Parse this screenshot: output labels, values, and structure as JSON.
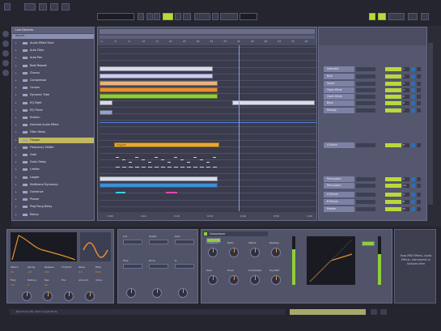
{
  "transport": {
    "buttons": [
      "",
      "",
      "",
      "",
      "",
      "",
      "",
      "",
      "",
      "",
      "",
      "",
      "",
      ""
    ],
    "tempo": "",
    "cpu": "",
    "key": "KEY",
    "midi": "MIDI"
  },
  "browser": {
    "title": "Live Devices",
    "subtitle": "Sound",
    "items": [
      "Audio Effect Rack",
      "Auto Filter",
      "Auto Pan",
      "Beat Repeat",
      "Chorus",
      "Compressor",
      "Corpus",
      "Dynamic Tube",
      "EQ Eight",
      "EQ Three",
      "Erosion",
      "External Audio Effect",
      "Filter Delay",
      "Flanger",
      "Frequency Shifter",
      "Gate",
      "Grain Delay",
      "Limiter",
      "Looper",
      "Multiband Dynamics",
      "Overdrive",
      "Phaser",
      "Ping Pong Delay",
      "Redux"
    ],
    "selected_index": 13
  },
  "arrangement": {
    "ruler": [
      "1",
      "5",
      "9",
      "13",
      "17",
      "21",
      "25",
      "29",
      "33",
      "37",
      "41",
      "45",
      "49",
      "53",
      "57",
      "61"
    ],
    "bottom_ruler": [
      "0:00",
      "0:10",
      "0:20",
      "0:30",
      "0:40",
      "0:50",
      "1:00"
    ],
    "clip_labels": [
      "",
      "",
      "",
      "",
      "",
      "",
      "",
      "",
      "4 Synth"
    ]
  },
  "mixer": {
    "tracks": [
      {
        "name": "Selected",
        "num": "1"
      },
      {
        "name": "Kick",
        "num": "2"
      },
      {
        "name": "Snare",
        "num": "3"
      },
      {
        "name": "Open Hihat",
        "num": "4"
      },
      {
        "name": "Open Hihat",
        "num": "5"
      },
      {
        "name": "Bass",
        "num": "6"
      },
      {
        "name": "Melody",
        "num": "7"
      },
      {
        "name": "4 Synth",
        "num": "8"
      },
      {
        "name": "Percussion",
        "num": "9"
      },
      {
        "name": "Percussion",
        "num": "10"
      },
      {
        "name": "A Return",
        "num": "A"
      },
      {
        "name": "B Return",
        "num": "B"
      },
      {
        "name": "Master",
        "num": "M"
      }
    ]
  },
  "devices": {
    "synth": {
      "labels": [
        "Attack",
        "Decay",
        "Release",
        "Time/Hz",
        "Wave",
        "Filter",
        "Freq",
        "Detune",
        "Res",
        "Env",
        "Amount",
        "Voice"
      ],
      "values": [
        "30",
        "-24",
        "100",
        "",
        "0.0",
        "10.0",
        "3.0",
        "0",
        "12",
        "",
        "",
        ""
      ]
    },
    "eq": {
      "labels": [
        "Cut",
        "Shape",
        "Gain",
        "Freq",
        "Drive",
        "Q"
      ],
      "values": [
        "",
        "",
        "",
        "",
        "",
        ""
      ]
    },
    "compressor": {
      "title": "Compressor",
      "labels": [
        "Threshold",
        "Ratio",
        "Attack",
        "Release",
        "Gain",
        "Knee",
        "Lookahead",
        "Dry/Wet"
      ],
      "values": [
        "",
        "",
        "",
        "",
        "",
        "",
        "",
        ""
      ]
    },
    "info_text": "Drag MIDI Effects, Audio Effects, Instruments or Samples Here"
  },
  "status": {
    "text": "Next Track Rec Start Length Mode"
  },
  "colors": {
    "accent": "#b9d93a",
    "selection": "#c2b960",
    "panel": "#54576e",
    "clip_orange": "#e8912f",
    "clip_blue": "#3c8fd6",
    "clip_white": "#d8dcec"
  }
}
